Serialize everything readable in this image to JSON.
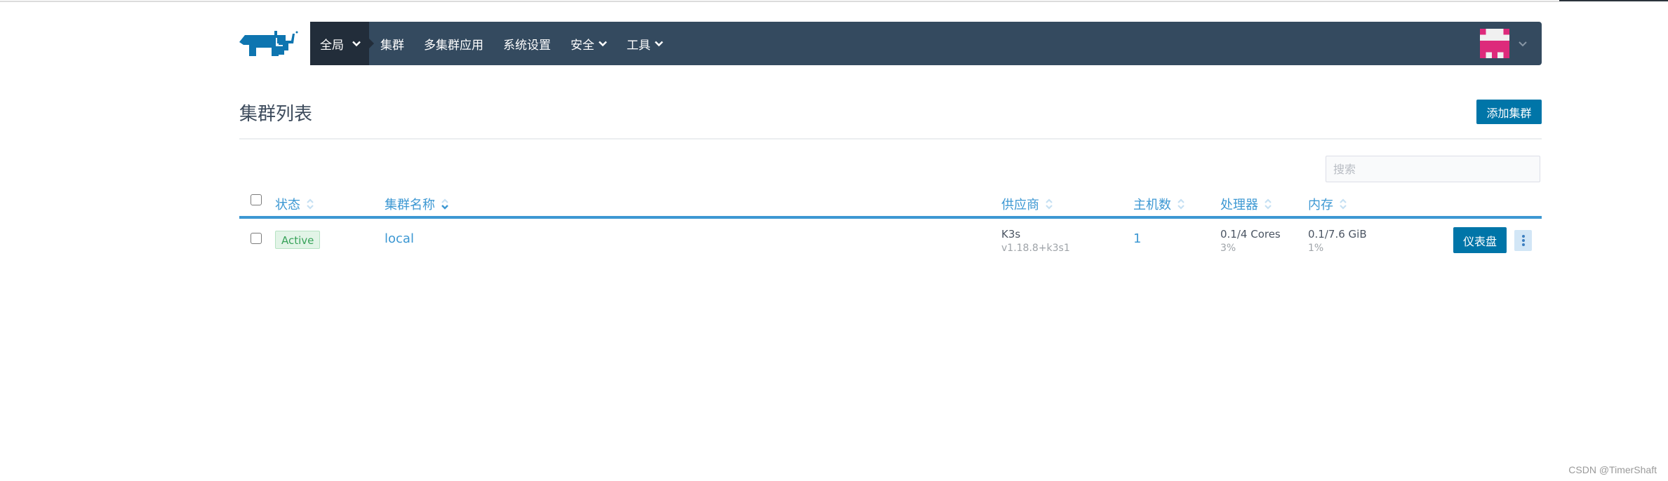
{
  "nav": {
    "items": [
      {
        "label": "全局",
        "dropdown": true,
        "active": true
      },
      {
        "label": "集群",
        "dropdown": false,
        "active": false
      },
      {
        "label": "多集群应用",
        "dropdown": false,
        "active": false
      },
      {
        "label": "系统设置",
        "dropdown": false,
        "active": false
      },
      {
        "label": "安全",
        "dropdown": true,
        "active": false
      },
      {
        "label": "工具",
        "dropdown": true,
        "active": false
      }
    ],
    "logo_icon": "rancher-logo",
    "user_avatar_icon": "identicon-avatar"
  },
  "page": {
    "title": "集群列表",
    "add_button": "添加集群",
    "search_placeholder": "搜索"
  },
  "table": {
    "columns": [
      "状态",
      "集群名称",
      "供应商",
      "主机数",
      "处理器",
      "内存"
    ],
    "rows": [
      {
        "state": "Active",
        "name": "local",
        "provider": "K3s",
        "provider_version": "v1.18.8+k3s1",
        "nodes": "1",
        "cpu": "0.1/4 Cores",
        "cpu_pct": "3%",
        "memory": "0.1/7.6 GiB",
        "memory_pct": "1%",
        "action": "仪表盘"
      }
    ]
  },
  "colors": {
    "navbar": "#344a5f",
    "navbar_active": "#222d3a",
    "primary": "#0075a8",
    "link": "#3d98d3",
    "active_badge": "#38a35a",
    "avatar": "#dd2a7b"
  },
  "watermark": "CSDN @TimerShaft"
}
